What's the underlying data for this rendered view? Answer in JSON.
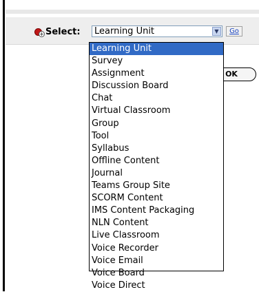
{
  "select_row": {
    "label": "Select:",
    "selected_value": "Learning Unit",
    "arrow_icon": "chevron-down",
    "go_label": "Go"
  },
  "ok_button": {
    "label": "OK"
  },
  "dropdown": {
    "selected_index": 0,
    "options": [
      "Learning Unit",
      "Survey",
      "Assignment",
      "Discussion Board",
      "Chat",
      "Virtual Classroom",
      "Group",
      "Tool",
      "Syllabus",
      "Offline Content",
      "Journal",
      "Teams Group Site",
      "SCORM Content",
      "IMS Content Packaging",
      "NLN Content",
      "Live Classroom",
      "Voice Recorder",
      "Voice Email",
      "Voice Board",
      "Voice Direct"
    ]
  },
  "colors": {
    "highlight": "#316ac5",
    "row_background": "#eeeeee",
    "icon_red": "#c01818"
  }
}
